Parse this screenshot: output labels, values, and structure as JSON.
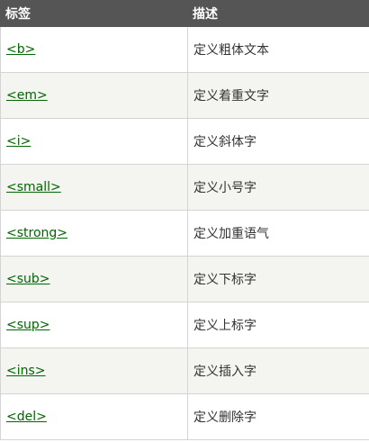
{
  "table": {
    "headers": [
      "标签",
      "描述"
    ],
    "rows": [
      {
        "tag": "<b>",
        "desc": "定义粗体文本"
      },
      {
        "tag": "<em>",
        "desc": "定义着重文字"
      },
      {
        "tag": "<i>",
        "desc": "定义斜体字"
      },
      {
        "tag": "<small>",
        "desc": "定义小号字"
      },
      {
        "tag": "<strong>",
        "desc": "定义加重语气"
      },
      {
        "tag": "<sub>",
        "desc": "定义下标字"
      },
      {
        "tag": "<sup>",
        "desc": "定义上标字"
      },
      {
        "tag": "<ins>",
        "desc": "定义插入字"
      },
      {
        "tag": "<del>",
        "desc": "定义删除字"
      }
    ]
  },
  "colors": {
    "header_bg": "#555555",
    "link": "#006600",
    "alt_row_bg": "#f4f4f0"
  }
}
